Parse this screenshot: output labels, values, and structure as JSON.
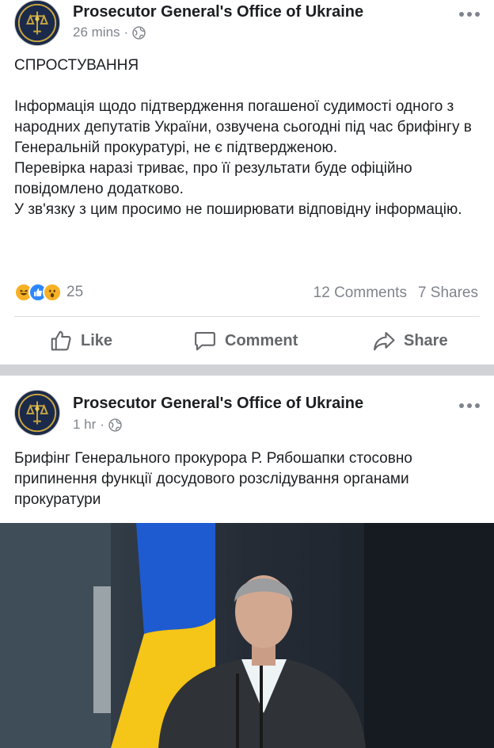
{
  "posts": [
    {
      "page_name": "Prosecutor General's Office of Ukraine",
      "time": "26 mins",
      "separator": "·",
      "privacy_icon": "globe-icon",
      "heading": "СПРОСТУВАННЯ",
      "body": "Інформація щодо підтвердження погашеної судимості одного з народних депутатів України, озвучена сьогодні під час брифінгу в Генеральній прокуратурі, не є підтвердженою.\nПеревірка наразі триває, про її результати  буде офіційно повідомлено додатково.\nУ зв'язку з цим просимо не поширювати відповідну інформацію.",
      "reactions": {
        "icons": [
          "haha-icon",
          "like-icon",
          "wow-icon"
        ],
        "count": "25"
      },
      "comments": "12 Comments",
      "shares": "7 Shares",
      "actions": {
        "like": "Like",
        "comment": "Comment",
        "share": "Share"
      }
    },
    {
      "page_name": "Prosecutor General's Office of Ukraine",
      "time": "1 hr",
      "separator": "·",
      "privacy_icon": "globe-icon",
      "body": "Брифінг Генерального прокурора Р. Рябошапки стосовно припинення функції досудового розслідування органами прокуратури"
    }
  ],
  "colors": {
    "name": "#1c1e21",
    "meta": "#7f848c",
    "like_blue": "#2d88ff",
    "reaction_yellow": "#f7b125",
    "divider": "#d0d2d6"
  }
}
